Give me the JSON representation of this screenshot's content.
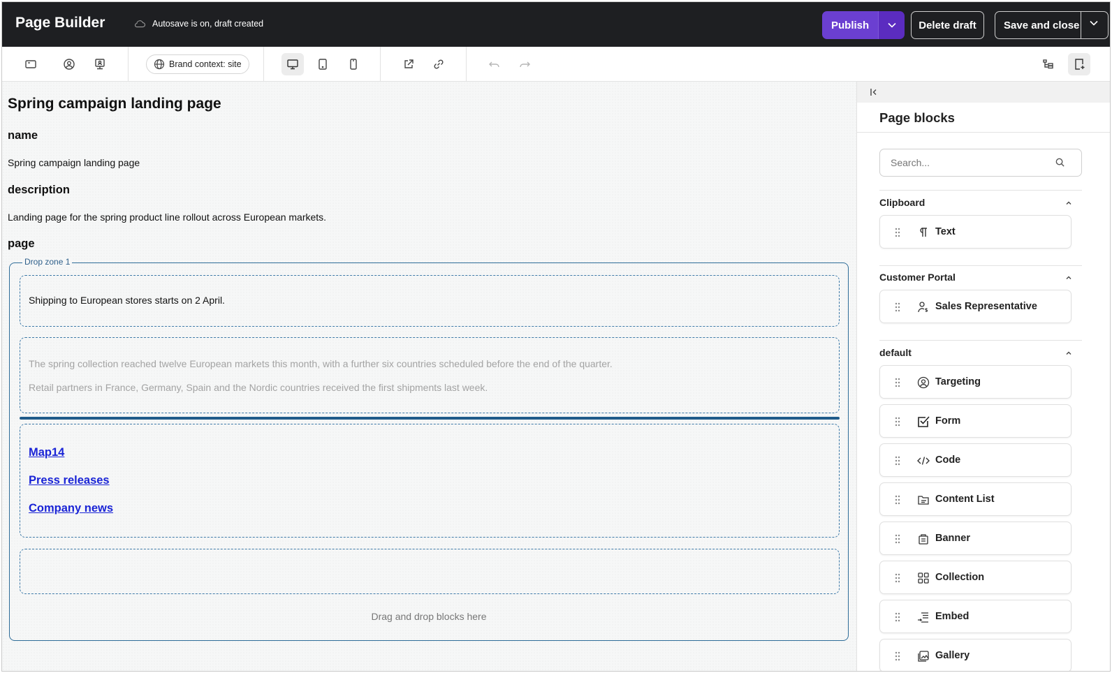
{
  "header": {
    "app_title": "Page Builder",
    "autosave_text": "Autosave is on, draft created",
    "publish_label": "Publish",
    "delete_label": "Delete draft",
    "save_close_label": "Save and close"
  },
  "toolbar": {
    "brand_context": "Brand context: site"
  },
  "canvas": {
    "page_title": "Spring campaign landing page",
    "name_heading": "name",
    "name_value": "Spring campaign landing page",
    "description_heading": "description",
    "description_value": "Landing page for the spring product line rollout across European markets.",
    "page_heading": "page",
    "dropzone_label": "Drop zone 1",
    "block1_text": "Shipping to European stores starts on 2 April.",
    "block2_line1": "The spring collection reached twelve European markets this month, with a further six countries scheduled before the end of the quarter.",
    "block2_line2": "Retail partners in France, Germany, Spain and the Nordic countries received the first shipments last week.",
    "links": [
      "Map14",
      "Press releases",
      "Company news"
    ],
    "drop_hint": "Drag and drop blocks here"
  },
  "panel": {
    "title": "Page blocks",
    "search_placeholder": "Search...",
    "sections": [
      {
        "name": "Clipboard",
        "items": [
          {
            "label": "Text",
            "icon": "paragraph-icon"
          }
        ]
      },
      {
        "name": "Customer Portal",
        "items": [
          {
            "label": "Sales Representative",
            "icon": "user-dollar-icon"
          }
        ]
      },
      {
        "name": "default",
        "items": [
          {
            "label": "Targeting",
            "icon": "user-circle-icon"
          },
          {
            "label": "Form",
            "icon": "checkbox-icon"
          },
          {
            "label": "Code",
            "icon": "code-icon"
          },
          {
            "label": "Content List",
            "icon": "content-list-icon"
          },
          {
            "label": "Banner",
            "icon": "banner-icon"
          },
          {
            "label": "Collection",
            "icon": "grid-icon"
          },
          {
            "label": "Embed",
            "icon": "embed-icon"
          },
          {
            "label": "Gallery",
            "icon": "gallery-icon"
          }
        ]
      }
    ]
  },
  "colors": {
    "topbar": "#1e1f22",
    "publish": "#6b3fd1",
    "dropzone_border": "#2e6c98",
    "link": "#1a24d6"
  }
}
